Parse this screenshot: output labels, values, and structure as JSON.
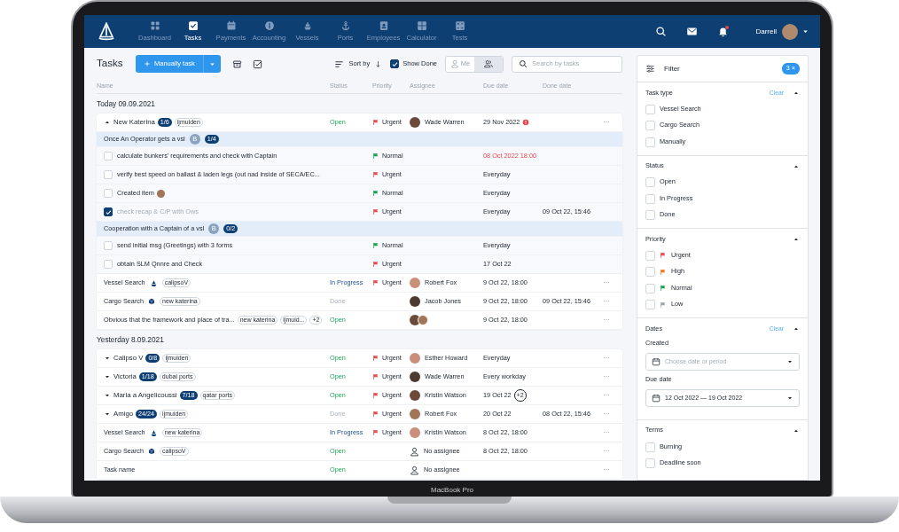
{
  "nav": {
    "items": [
      {
        "label": "Dashboard",
        "kind": "grid",
        "selected": false
      },
      {
        "label": "Tasks",
        "kind": "check",
        "selected": true
      },
      {
        "label": "Payments",
        "kind": "calendar",
        "selected": false
      },
      {
        "label": "Accounting",
        "kind": "coin",
        "selected": false
      },
      {
        "label": "Vessels",
        "kind": "ship",
        "selected": false
      },
      {
        "label": "Ports",
        "kind": "anchor",
        "selected": false
      },
      {
        "label": "Employees",
        "kind": "id",
        "selected": false
      },
      {
        "label": "Calculator",
        "kind": "calc",
        "selected": false
      },
      {
        "label": "Tests",
        "kind": "tests",
        "selected": false
      }
    ],
    "bell_unread": true,
    "user": "Darrell"
  },
  "toolbar": {
    "title": "Tasks",
    "add_button": "Manually task",
    "sort": "Sort by",
    "show_done": {
      "label": "Show Done",
      "checked": true
    },
    "view_toggle": [
      {
        "label": "Me",
        "kind": "person",
        "selected": false
      },
      {
        "kind": "people",
        "selected": true
      }
    ],
    "search": {
      "placeholder": "Search by tasks"
    }
  },
  "columns": [
    "Name",
    "Status",
    "Priority",
    "Assignee",
    "Due date",
    "Done date"
  ],
  "groups": [
    {
      "title": "Today 09.09.2021",
      "rows": [
        {
          "kind": "group",
          "name": "New Katerina",
          "expanded": true,
          "counter": "1/6",
          "tags": [
            "ijmuiden"
          ],
          "status": {
            "label": "Open",
            "kind": "open"
          },
          "priority": {
            "label": "Urgent",
            "kind": "urgent"
          },
          "assignee": {
            "kind": "avatar",
            "name": "Wade Warren"
          },
          "due": {
            "text": "29 Nov 2022",
            "alert": true
          },
          "menu": "···"
        },
        {
          "kind": "section",
          "name": "Once An Operator gets a vsl",
          "initial": "B",
          "counter": "1/4"
        },
        {
          "kind": "subtask",
          "checked": false,
          "name": "calculate bunkers' requirements and check with Captain",
          "has_avatar": false,
          "priority": {
            "label": "Normal",
            "kind": "normal"
          },
          "due": {
            "text": "08 Oct 2022 18:00",
            "overdue": true
          }
        },
        {
          "kind": "subtask",
          "checked": false,
          "name": "verify best speed on ballast & laden legs (out nad inside of SECA/EC...",
          "has_avatar": false,
          "priority": {
            "label": "Urgent",
            "kind": "urgent"
          },
          "due": {
            "text": "Everyday"
          }
        },
        {
          "kind": "subtask",
          "checked": false,
          "name": "Created item",
          "has_avatar": true,
          "priority": {
            "label": "Normal",
            "kind": "normal"
          },
          "due": {
            "text": "Everyday"
          }
        },
        {
          "kind": "subtask",
          "checked": true,
          "name": "check recap & C/P with Ows",
          "has_avatar": false,
          "priority": {
            "label": "Urgent",
            "kind": "urgent"
          },
          "due": {
            "text": "Everyday"
          },
          "done": "09 Oct 22, 15:46"
        },
        {
          "kind": "section",
          "name": "Cooperation with a Captain of a vsl",
          "initial": "B",
          "counter": "0/2"
        },
        {
          "kind": "subtask",
          "checked": false,
          "name": "send initial msg (Greetings) with 3 forms",
          "has_avatar": false,
          "priority": {
            "label": "Normal",
            "kind": "normal"
          },
          "due": {
            "text": "Everyday"
          }
        },
        {
          "kind": "subtask",
          "checked": false,
          "name": "obtain SLM Qnnre and Check",
          "has_avatar": false,
          "priority": {
            "label": "Urgent",
            "kind": "urgent"
          },
          "due": {
            "text": "17 Oct 22"
          }
        },
        {
          "kind": "vessel",
          "name": "Vessel Search",
          "tags": [
            "calipsoV"
          ],
          "status": {
            "label": "In Progress",
            "kind": "progress"
          },
          "priority": {
            "label": "Urgent",
            "kind": "urgent"
          },
          "assignee": {
            "kind": "avatar",
            "name": "Robert Fox"
          },
          "due": {
            "text": "9 Oct 22, 18:00"
          },
          "menu": "···"
        },
        {
          "kind": "cargo",
          "name": "Cargo Search",
          "tags": [
            "new katerina"
          ],
          "status": {
            "label": "Done",
            "kind": "done"
          },
          "assignee": {
            "kind": "avatar",
            "name": "Jacob Jones"
          },
          "due": {
            "text": "9 Oct 22, 18:00"
          },
          "done": "09 Oct 22, 15:46",
          "menu": "···"
        },
        {
          "kind": "plain",
          "name": "Obvious that the framework and place of tra...",
          "tags": [
            "new katerina",
            "ijmuid...",
            "+2"
          ],
          "status": {
            "label": "Open",
            "kind": "open"
          },
          "assignee": {
            "kind": "pair"
          },
          "due": {
            "text": "9 Oct 22, 18:00"
          },
          "menu": "···"
        }
      ]
    },
    {
      "title": "Yesterday 8.09.2021",
      "rows": [
        {
          "kind": "group",
          "name": "Calipso V",
          "expanded": false,
          "counter": "0/8",
          "tags": [
            "ijmuiden"
          ],
          "status": {
            "label": "Open",
            "kind": "open"
          },
          "priority": {
            "label": "Urgent",
            "kind": "urgent"
          },
          "assignee": {
            "kind": "avatar",
            "name": "Esther Howard"
          },
          "due": {
            "text": "Everyday"
          },
          "menu": "···"
        },
        {
          "kind": "group",
          "name": "Victoria",
          "expanded": false,
          "counter": "1/18",
          "tags": [
            "dubai ports"
          ],
          "status": {
            "label": "Open",
            "kind": "open"
          },
          "priority": {
            "label": "Urgent",
            "kind": "urgent"
          },
          "assignee": {
            "kind": "avatar",
            "name": "Wade Warren"
          },
          "due": {
            "text": "Every workday"
          },
          "menu": "···"
        },
        {
          "kind": "group",
          "name": "Maria a Angelicoussi",
          "expanded": false,
          "counter": "7/18",
          "tags": [
            "qatar ports"
          ],
          "status": {
            "label": "Open",
            "kind": "open"
          },
          "priority": {
            "label": "Urgent",
            "kind": "urgent"
          },
          "assignee": {
            "kind": "avatar",
            "name": "Kristin Watson"
          },
          "due": {
            "text": "19 Oct 22",
            "extra": "+2"
          },
          "menu": "···"
        },
        {
          "kind": "group",
          "name": "Amigo",
          "expanded": false,
          "counter": "24/24",
          "tags": [
            "ijmuiden"
          ],
          "status": {
            "label": "Done",
            "kind": "done"
          },
          "priority": {
            "label": "Urgent",
            "kind": "urgent"
          },
          "assignee": {
            "kind": "avatar",
            "name": "Robert Fox"
          },
          "due": {
            "text": "20 Oct 22"
          },
          "done": "08 Oct 22, 15:46",
          "menu": "···"
        },
        {
          "kind": "vessel",
          "name": "Vessel Search",
          "tags": [
            "new katerina"
          ],
          "status": {
            "label": "In Progress",
            "kind": "progress"
          },
          "priority": {
            "label": "Urgent",
            "kind": "urgent"
          },
          "assignee": {
            "kind": "avatar",
            "name": "Kristin Watson"
          },
          "due": {
            "text": "8 Oct 22, 18:00"
          },
          "menu": "···"
        },
        {
          "kind": "cargo",
          "name": "Cargo Search",
          "tags": [
            "calipsoV"
          ],
          "status": {
            "label": "Open",
            "kind": "open"
          },
          "assignee": {
            "kind": "none",
            "name": "No assignee"
          },
          "due": {
            "text": "8 Oct 22, 18:00"
          },
          "menu": "···"
        },
        {
          "kind": "plain",
          "name": "Task name",
          "status": {
            "label": "Open",
            "kind": "open"
          },
          "assignee": {
            "kind": "none",
            "name": "No assignee"
          },
          "menu": "···"
        }
      ]
    }
  ],
  "filter": {
    "title": "Filter",
    "count": "3",
    "clear_mark": "×",
    "sections": [
      {
        "kind": "checks",
        "title": "Task type",
        "clear": "Clear",
        "expanded": true,
        "options": [
          {
            "label": "Vessel Search",
            "checked": false
          },
          {
            "label": "Cargo Search",
            "checked": false
          },
          {
            "label": "Manually",
            "checked": false
          }
        ]
      },
      {
        "kind": "checks",
        "title": "Status",
        "expanded": true,
        "options": [
          {
            "label": "Open",
            "checked": false
          },
          {
            "label": "In Progress",
            "checked": false
          },
          {
            "label": "Done",
            "checked": false
          }
        ]
      },
      {
        "kind": "checks",
        "title": "Priority",
        "expanded": true,
        "options": [
          {
            "label": "Urgent",
            "kind": "urgent",
            "checked": false
          },
          {
            "label": "High",
            "kind": "high",
            "checked": false
          },
          {
            "label": "Normal",
            "kind": "normal",
            "checked": false
          },
          {
            "label": "Low",
            "kind": "low",
            "checked": false
          }
        ]
      },
      {
        "kind": "dates",
        "title": "Dates",
        "clear": "Clear",
        "expanded": true,
        "fields": [
          {
            "label": "Created",
            "placeholder": "Choose date or period"
          },
          {
            "label": "Due date",
            "value": "12 Oct 2022 — 19 Oct 2022"
          }
        ]
      },
      {
        "kind": "checks",
        "title": "Terms",
        "expanded": true,
        "options": [
          {
            "label": "Burning",
            "checked": false
          },
          {
            "label": "Deadline soon",
            "checked": false
          }
        ]
      }
    ]
  },
  "device_label": "MacBook Pro"
}
